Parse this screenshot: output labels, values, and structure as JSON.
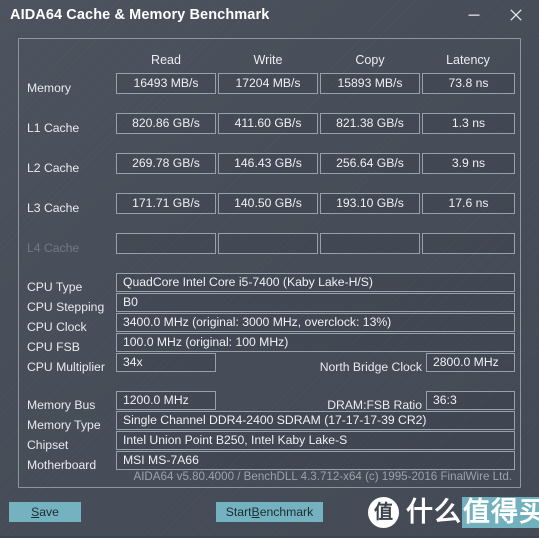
{
  "window": {
    "title": "AIDA64 Cache & Memory Benchmark",
    "minimize_label": "minimize",
    "close_label": "close"
  },
  "benchmark_table": {
    "columns": [
      "Read",
      "Write",
      "Copy",
      "Latency"
    ],
    "rows": [
      {
        "label": "Memory",
        "disabled": false,
        "read": "16493 MB/s",
        "write": "17204 MB/s",
        "copy": "15893 MB/s",
        "latency": "73.8 ns"
      },
      {
        "label": "L1 Cache",
        "disabled": false,
        "read": "820.86 GB/s",
        "write": "411.60 GB/s",
        "copy": "821.38 GB/s",
        "latency": "1.3 ns"
      },
      {
        "label": "L2 Cache",
        "disabled": false,
        "read": "269.78 GB/s",
        "write": "146.43 GB/s",
        "copy": "256.64 GB/s",
        "latency": "3.9 ns"
      },
      {
        "label": "L3 Cache",
        "disabled": false,
        "read": "171.71 GB/s",
        "write": "140.50 GB/s",
        "copy": "193.10 GB/s",
        "latency": "17.6 ns"
      },
      {
        "label": "L4 Cache",
        "disabled": true,
        "read": "",
        "write": "",
        "copy": "",
        "latency": ""
      }
    ]
  },
  "cpu_info": {
    "cpu_type_label": "CPU Type",
    "cpu_type_value": "QuadCore Intel Core i5-7400  (Kaby Lake-H/S)",
    "cpu_stepping_label": "CPU Stepping",
    "cpu_stepping_value": "B0",
    "cpu_clock_label": "CPU Clock",
    "cpu_clock_value": "3400.0 MHz  (original: 3000 MHz, overclock: 13%)",
    "cpu_fsb_label": "CPU FSB",
    "cpu_fsb_value": "100.0 MHz  (original: 100 MHz)",
    "cpu_multiplier_label": "CPU Multiplier",
    "cpu_multiplier_value": "34x",
    "north_bridge_clock_label": "North Bridge Clock",
    "north_bridge_clock_value": "2800.0 MHz"
  },
  "memory_info": {
    "memory_bus_label": "Memory Bus",
    "memory_bus_value": "1200.0 MHz",
    "dram_fsb_ratio_label": "DRAM:FSB Ratio",
    "dram_fsb_ratio_value": "36:3",
    "memory_type_label": "Memory Type",
    "memory_type_value": "Single Channel DDR4-2400 SDRAM  (17-17-17-39 CR2)",
    "chipset_label": "Chipset",
    "chipset_value": "Intel Union Point B250, Intel Kaby Lake-S",
    "motherboard_label": "Motherboard",
    "motherboard_value": "MSI MS-7A66"
  },
  "footer": {
    "version_text": "AIDA64 v5.80.4000 / BenchDLL 4.3.712-x64  (c) 1995-2016 FinalWire Ltd.",
    "save_accel": "S",
    "save_rest": "ave",
    "start_pre": "Start ",
    "start_accel": "B",
    "start_rest": "enchmark"
  },
  "watermark": {
    "badge_char": "值",
    "text_plain": "什么",
    "text_highlight": "值得买"
  },
  "colors": {
    "window_bg": "#474e59",
    "accent_teal": "#74b2bf",
    "cell_border": "#97a0ab",
    "text_primary": "#eef1f4",
    "text_dim": "#6f7a86",
    "version_text": "#9aa3ad"
  }
}
